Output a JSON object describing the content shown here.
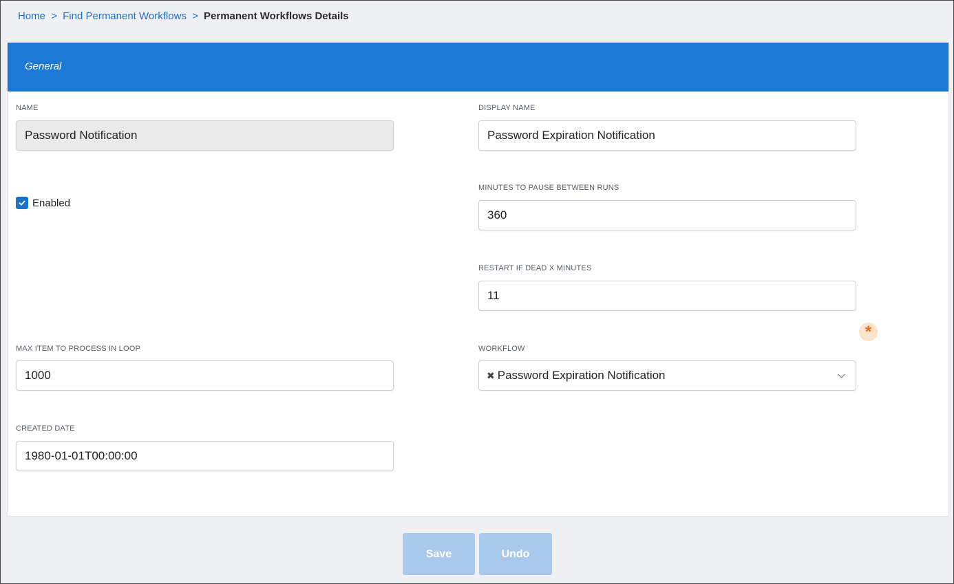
{
  "breadcrumb": {
    "home": "Home",
    "separator": ">",
    "find": "Find Permanent Workflows",
    "current": "Permanent Workflows Details"
  },
  "section": {
    "title": "General"
  },
  "fields": {
    "name": {
      "label": "NAME",
      "value": "Password Notification"
    },
    "display_name": {
      "label": "DISPLAY NAME",
      "value": "Password Expiration Notification"
    },
    "enabled": {
      "label": "Enabled",
      "checked": true
    },
    "minutes_pause": {
      "label": "MINUTES TO PAUSE BETWEEN RUNS",
      "value": "360"
    },
    "restart_dead": {
      "label": "RESTART IF DEAD X MINUTES",
      "value": "11"
    },
    "max_items": {
      "label": "MAX ITEM TO PROCESS IN LOOP",
      "value": "1000"
    },
    "workflow": {
      "label": "WORKFLOW",
      "value": "Password Expiration Notification",
      "clear_icon": "×-icon",
      "required_marker": "*"
    },
    "created_date": {
      "label": "CREATED DATE",
      "value": "1980-01-01T00:00:00"
    }
  },
  "buttons": {
    "save": "Save",
    "undo": "Undo"
  },
  "colors": {
    "header": "#1b78d4",
    "link": "#1f6fc9",
    "button_disabled": "#a9c9ec",
    "required": "#e2701e"
  }
}
